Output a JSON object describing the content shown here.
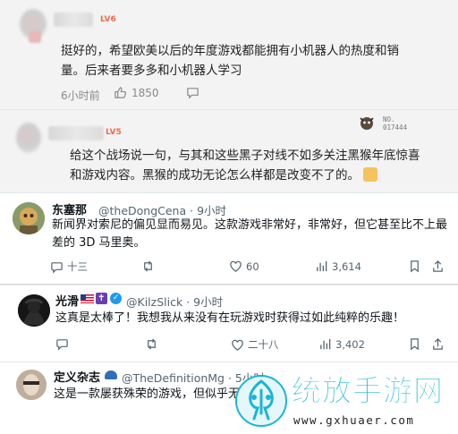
{
  "comment1": {
    "level_badge": "LV6",
    "text_line1": "挺好的，希望欧美以后的年度游戏都能拥有小机器人的热度和销",
    "text_line2": "量。后来者要多多和小机器人学习",
    "time": "6小时前",
    "like_count": "1850"
  },
  "comment2": {
    "level_badge": "LV5",
    "number_badge": "NO.\n017444",
    "text_line1": "给这个战场说一句，与其和这些黑子对线不如多关注黑猴年底惊喜",
    "text_line2": "和游戏内容。黑猴的成功无论怎么样都是改变不了的。"
  },
  "tweet1": {
    "name": "东塞那",
    "handle": "@theDongCena",
    "time": "· 9小时",
    "text_line1": "新闻界对索尼的偏见显而易见。这款游戏非常好，非常好，但它甚至比不上最",
    "text_line2": "差的 3D 马里奥。",
    "reply_count": "十三",
    "like_count": "60",
    "view_count": "3,614"
  },
  "tweet2": {
    "name": "光滑",
    "handle": "@KilzSlick",
    "time": "· 9小时",
    "text": "这真是太棒了！我想我从来没有在玩游戏时获得过如此纯粹的乐趣！",
    "like_count": "二十八",
    "view_count": "3,402"
  },
  "tweet3": {
    "name": "定义杂志",
    "handle": "@TheDefinitionMg",
    "time": "· 5小时",
    "text": "这是一款屡获殊荣的游戏，但似乎无"
  },
  "watermark": {
    "title": "统放手游网",
    "url": "www.gxhuaer.com"
  },
  "colors": {
    "accent_blue": "#1d9bf0",
    "level_orange": "#f06a4a",
    "watermark_cyan": "#19b6d8"
  }
}
